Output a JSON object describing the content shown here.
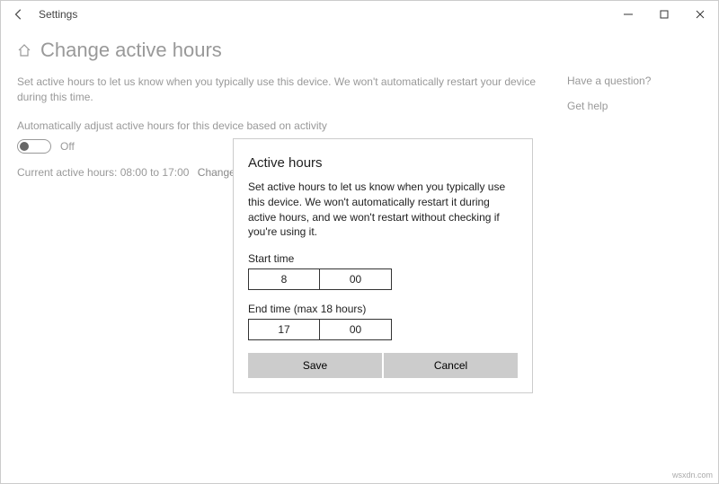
{
  "window": {
    "title": "Settings"
  },
  "header": {
    "title": "Change active hours"
  },
  "main": {
    "description": "Set active hours to let us know when you typically use this device. We won't automatically restart your device during this time.",
    "auto_adjust_label": "Automatically adjust active hours for this device based on activity",
    "toggle_state": "Off",
    "current_hours_prefix": "Current active hours: ",
    "current_hours_value": "08:00 to 17:00",
    "change_link": "Change"
  },
  "aside": {
    "question": "Have a question?",
    "get_help": "Get help"
  },
  "dialog": {
    "title": "Active hours",
    "description": "Set active hours to let us know when you typically use this device. We won't automatically restart it during active hours, and we won't restart without checking if you're using it.",
    "start_label": "Start time",
    "start_hour": "8",
    "start_minute": "00",
    "end_label": "End time (max 18 hours)",
    "end_hour": "17",
    "end_minute": "00",
    "save_label": "Save",
    "cancel_label": "Cancel"
  },
  "watermark": "wsxdn.com"
}
